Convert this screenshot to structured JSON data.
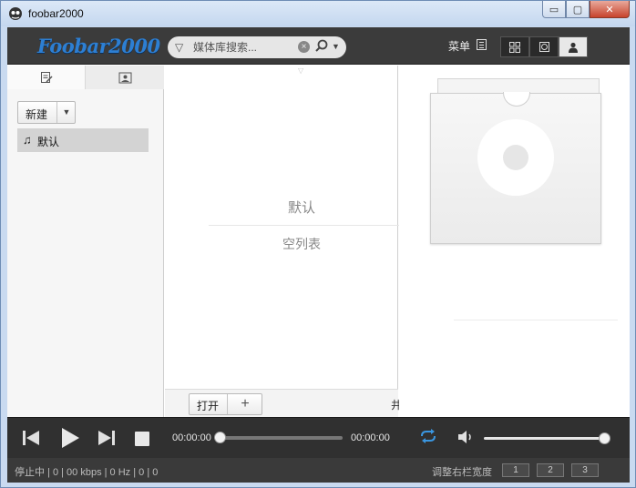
{
  "window": {
    "title": "foobar2000",
    "controls": {
      "minimize": "▭",
      "maximize": "▢",
      "close": "✕"
    }
  },
  "header": {
    "logo": "Foobar2000",
    "search": {
      "placeholder": "媒体库搜索..."
    },
    "menu_label": "菜单",
    "views": [
      {
        "icon": "grid-icon",
        "active": false
      },
      {
        "icon": "cd-icon",
        "active": false
      },
      {
        "icon": "user-icon",
        "active": true
      }
    ]
  },
  "left_panel": {
    "tabs": [
      {
        "icon": "playlist-edit-icon",
        "active": true
      },
      {
        "icon": "image-icon",
        "active": false
      }
    ],
    "new_button": "新建",
    "playlists": [
      {
        "label": "默认",
        "icon": "music-note-icon",
        "selected": true
      }
    ]
  },
  "middle_panel": {
    "title": "默认",
    "empty_text": "空列表",
    "open_button": "打开",
    "add_symbol": "+",
    "cut_text": "井"
  },
  "player": {
    "current_time": "00:00:00",
    "total_time": "00:00:00",
    "progress": 0,
    "volume": 1.0,
    "accent": "#3a96e0"
  },
  "status": {
    "text": "停止中 | 0 | 00 kbps | 0 Hz | 0 | 0",
    "right_label": "调整右栏宽度",
    "width_buttons": [
      "1",
      "2",
      "3"
    ]
  }
}
